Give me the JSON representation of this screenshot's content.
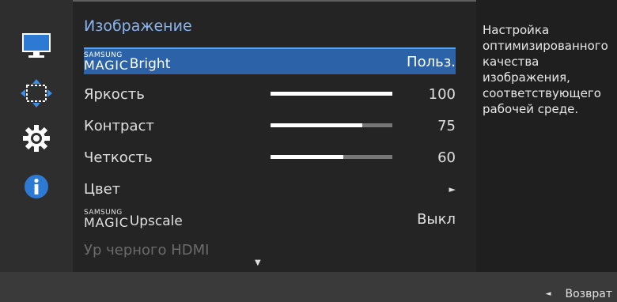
{
  "sidebar": {
    "items": [
      {
        "icon": "monitor-icon"
      },
      {
        "icon": "screen-position-icon"
      },
      {
        "icon": "gear-icon"
      },
      {
        "icon": "info-icon"
      }
    ]
  },
  "menu": {
    "title": "Изображение",
    "rows": [
      {
        "brand_top": "SAMSUNG",
        "brand_bottom": "MAGIC",
        "label": "Bright",
        "value": "Польз."
      },
      {
        "label": "Яркость",
        "value": "100",
        "level": 100
      },
      {
        "label": "Контраст",
        "value": "75",
        "level": 75
      },
      {
        "label": "Четкость",
        "value": "60",
        "level": 60
      },
      {
        "label": "Цвет",
        "value": "►"
      },
      {
        "brand_top": "SAMSUNG",
        "brand_bottom": "MAGIC",
        "label": "Upscale",
        "value": "Выкл"
      },
      {
        "label": "Ур черного HDMI",
        "value": ""
      }
    ],
    "scroll_indicator": "▼"
  },
  "description": {
    "text": "Настройка оптимизированного качества изображения, соответствующего рабочей среде."
  },
  "footer": {
    "back_arrow": "◄",
    "back_label": "Возврат"
  },
  "colors": {
    "accent": "#2c63a8",
    "title": "#8ab4f0"
  }
}
